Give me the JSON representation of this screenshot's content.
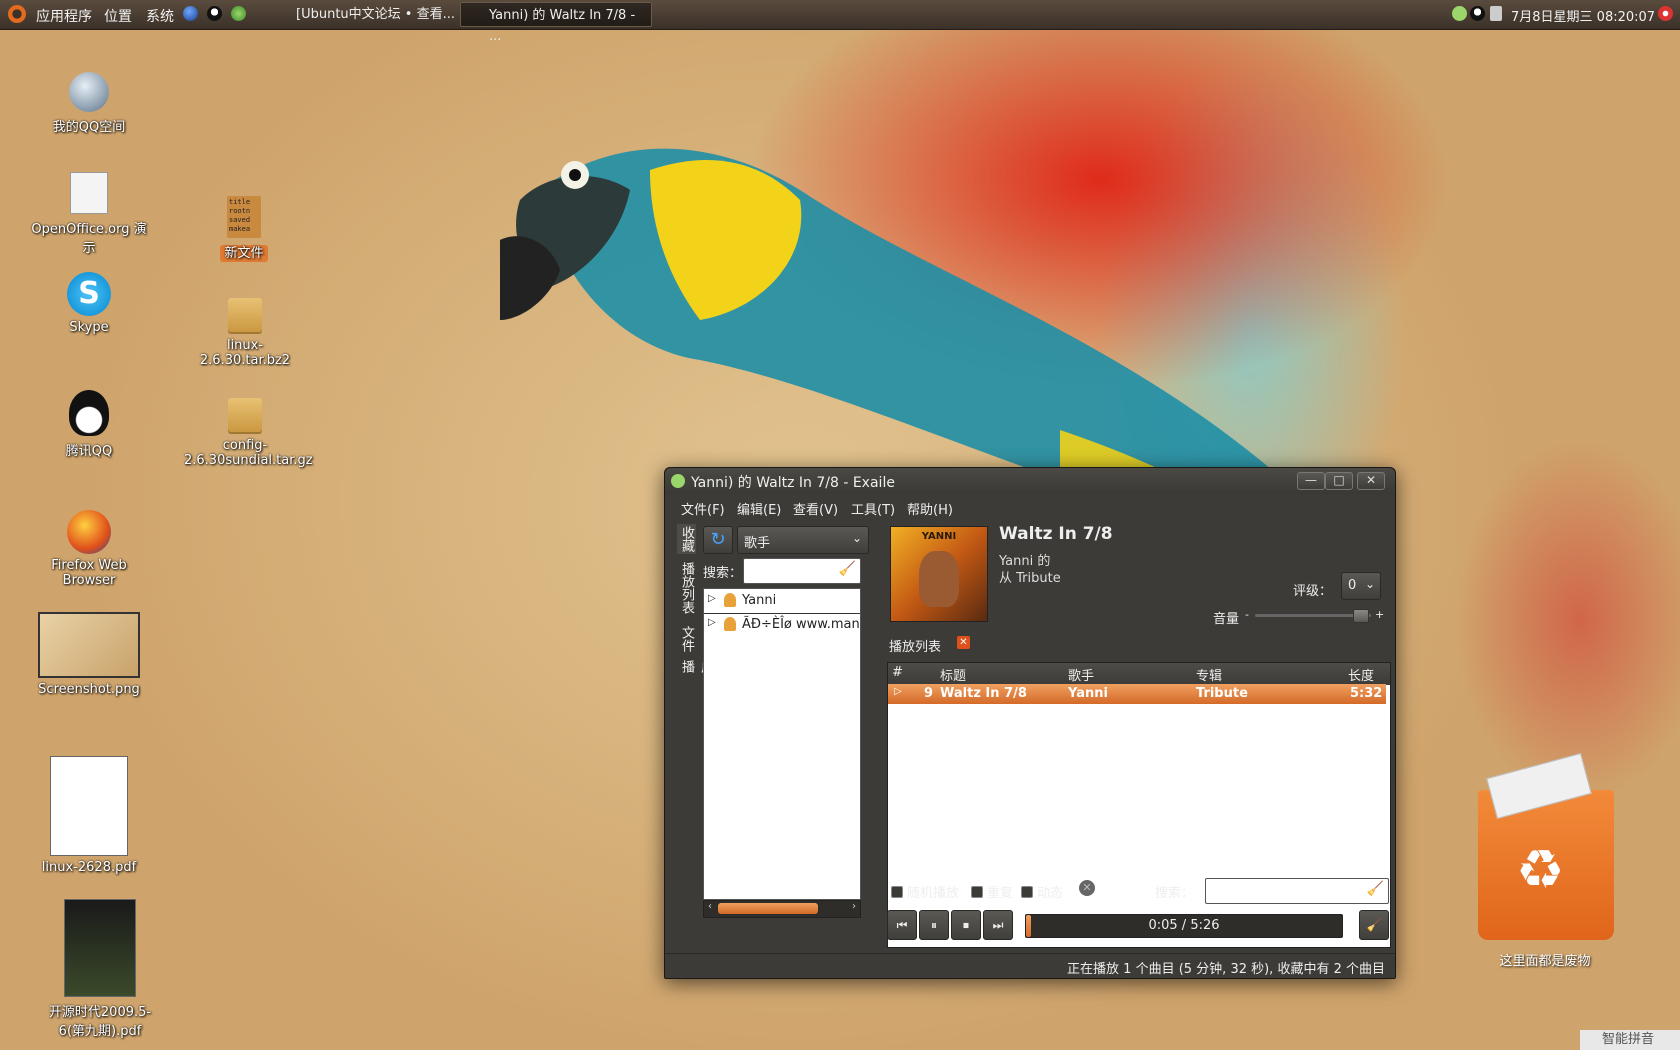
{
  "panel": {
    "menus": [
      "应用程序",
      "位置",
      "系统"
    ],
    "taskbar": [
      {
        "label": "[Ubuntu中文论坛 • 查看..."
      },
      {
        "label": "Yanni) 的 Waltz In 7/8 - ···"
      }
    ],
    "clock": "7月8日星期三 08:20:07"
  },
  "desktop": {
    "icons": [
      {
        "label": "我的QQ空间"
      },
      {
        "label": "OpenOffice.org 演示"
      },
      {
        "label": "Skype"
      },
      {
        "label": "腾讯QQ"
      },
      {
        "label": "Firefox Web Browser"
      },
      {
        "label": "Screenshot.png"
      },
      {
        "label": "linux-2628.pdf"
      },
      {
        "label": "开源时代2009.5-6(第九期).pdf"
      },
      {
        "label": "新文件",
        "preview": "title\nrootn\nsaved\nmakea"
      },
      {
        "label": "linux-2.6.30.tar.bz2"
      },
      {
        "label": "config-2.6.30sundial.tar.gz"
      }
    ],
    "trash_label": "这里面都是废物",
    "ime_label": "智能拼音"
  },
  "exaile": {
    "title": "Yanni) 的 Waltz In 7/8 - Exaile",
    "menu": [
      "文件(F)",
      "编辑(E)",
      "查看(V)",
      "工具(T)",
      "帮助(H)"
    ],
    "side_tabs": [
      "收藏",
      "播放列表",
      "文件",
      "广播"
    ],
    "library": {
      "view_select": "歌手",
      "search_label": "搜索：",
      "search_value": "",
      "items": [
        "Yanni",
        "ÃÐ÷ÈÎø www.manchan"
      ]
    },
    "now_playing": {
      "title": "Waltz In 7/8",
      "artist_line": "Yanni 的",
      "album_line": "从 Tribute",
      "cover_text": "YANNI",
      "rating_label": "评级：",
      "rating_value": "0",
      "volume_label": "音量",
      "volume_minus": "-",
      "volume_plus": "+",
      "volume": 0.95
    },
    "playlist": {
      "tab_label": "播放列表",
      "columns": [
        "#",
        "标题",
        "歌手",
        "专辑",
        "长度"
      ],
      "rows": [
        {
          "num": "9",
          "title": "Waltz In 7/8",
          "artist": "Yanni",
          "album": "Tribute",
          "length": "5:32"
        }
      ]
    },
    "options": {
      "shuffle": "随机播放",
      "repeat": "重复",
      "dynamic": "动态",
      "search_label": "搜索："
    },
    "progress": {
      "time": "0:05 / 5:26",
      "fraction": 0.015
    },
    "statusbar": "正在播放 1 个曲目 (5 分钟, 32 秒), 收藏中有 2 个曲目"
  },
  "colors": {
    "panel": "#3b3129",
    "accent": "#e07a32",
    "window_bg": "#3c3b37"
  }
}
